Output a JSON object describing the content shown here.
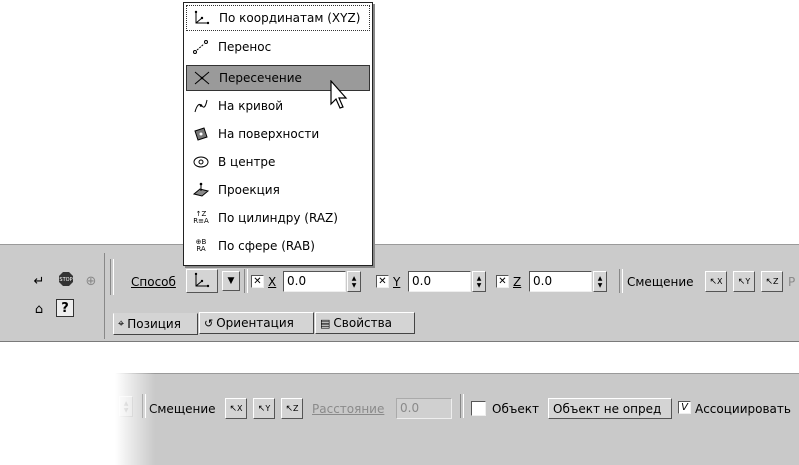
{
  "menu": {
    "items": [
      {
        "label": "По координатам (XYZ)",
        "icon": "xyz-axes-icon"
      },
      {
        "label": "Перенос",
        "icon": "transfer-points-icon"
      },
      {
        "label": "Пересечение",
        "icon": "intersection-icon"
      },
      {
        "label": "На кривой",
        "icon": "on-curve-icon"
      },
      {
        "label": "На поверхности",
        "icon": "on-surface-icon"
      },
      {
        "label": "В центре",
        "icon": "center-icon"
      },
      {
        "label": "Проекция",
        "icon": "projection-icon"
      },
      {
        "label": "По цилиндру (RAZ)",
        "icon": "cylinder-raz-icon"
      },
      {
        "label": "По сфере (RAB)",
        "icon": "sphere-rab-icon"
      }
    ],
    "selected_index": 0,
    "hovered_index": 2
  },
  "toolbar": {
    "method_label": "Способ",
    "x_label": "X",
    "x_value": "0.0",
    "y_label": "Y",
    "y_value": "0.0",
    "z_label": "Z",
    "z_value": "0.0",
    "offset_label": "Смещение",
    "offset_buttons": [
      "X",
      "Y",
      "Z"
    ],
    "offset_truncated": "Р",
    "tabs": [
      "Позиция",
      "Ориентация",
      "Свойства"
    ]
  },
  "toolbar2": {
    "offset_label": "Смещение",
    "offset_buttons": [
      "X",
      "Y",
      "Z"
    ],
    "distance_label": "Расстояние",
    "distance_value": "0.0",
    "object_label": "Объект",
    "object_value": "Объект не опред",
    "associate_label": "Ассоциировать",
    "associate_checked": true,
    "checkmark": "V"
  },
  "colors": {
    "panel": "#cbcbcb",
    "menu_highlight": "#9a9a9a"
  }
}
